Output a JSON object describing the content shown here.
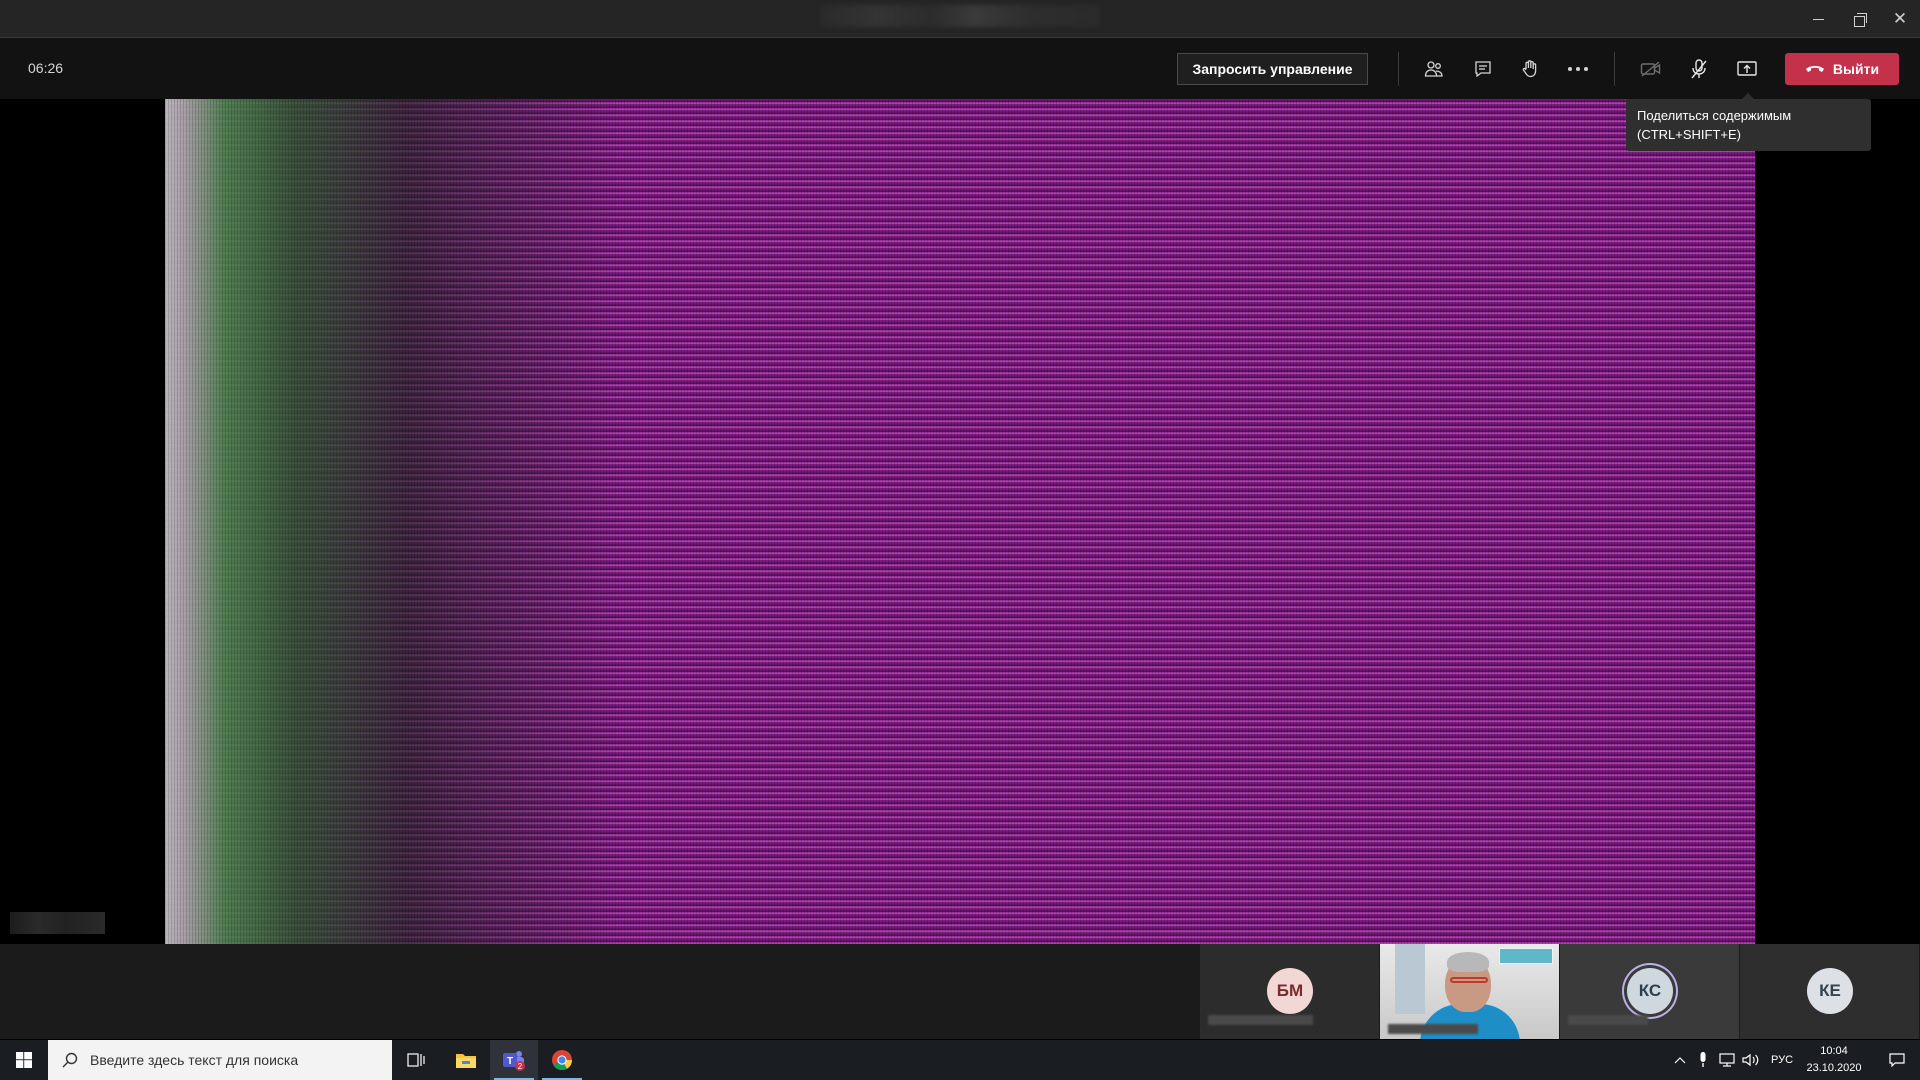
{
  "window": {
    "minimize_icon": "minimize-icon",
    "restore_icon": "restore-icon",
    "close_icon": "close-icon",
    "close_glyph": "✕"
  },
  "meeting": {
    "timer": "06:26",
    "request_control_label": "Запросить управление",
    "leave_label": "Выйти",
    "icons": [
      "participants-icon",
      "chat-icon",
      "raise-hand-icon",
      "more-actions-icon",
      "camera-off-icon",
      "microphone-icon",
      "share-screen-icon",
      "hang-up-icon"
    ],
    "leave_color": "#c4314b"
  },
  "tooltip": {
    "line1": "Поделиться содержимым",
    "line2": "(CTRL+SHIFT+E)"
  },
  "participants": [
    {
      "initials": "БМ",
      "type": "avatar"
    },
    {
      "initials": "",
      "type": "video"
    },
    {
      "initials": "КС",
      "type": "avatar",
      "speaking": true
    },
    {
      "initials": "КЕ",
      "type": "avatar"
    }
  ],
  "taskbar": {
    "search_placeholder": "Введите здесь текст для поиска",
    "apps": [
      "task-view-icon",
      "file-explorer-icon",
      "teams-icon",
      "chrome-icon"
    ],
    "teams_badge": "2",
    "language": "РУС",
    "time": "10:04",
    "date": "23.10.2020"
  }
}
